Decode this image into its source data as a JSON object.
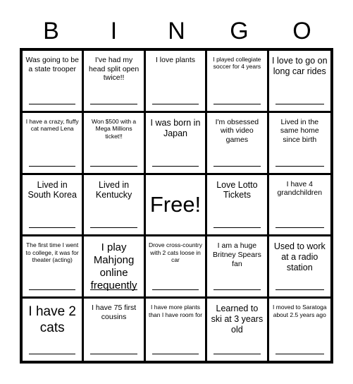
{
  "header": {
    "letters": [
      "B",
      "I",
      "N",
      "G",
      "O"
    ]
  },
  "grid": {
    "rows": [
      [
        {
          "text": "Was going to be a state trooper",
          "size": "sm",
          "line": true
        },
        {
          "text": "I've had my head split open twice!!",
          "size": "sm",
          "line": true
        },
        {
          "text": "I love plants",
          "size": "sm",
          "line": true
        },
        {
          "text": "I played collegiate soccer for 4 years",
          "size": "xs",
          "line": true
        },
        {
          "text": "I love to go on long car rides",
          "size": "md",
          "line": true
        }
      ],
      [
        {
          "text": "I have a crazy, fluffy cat named Lena",
          "size": "xs",
          "line": true
        },
        {
          "text": "Won $500 with a Mega Millions ticket!!",
          "size": "xs",
          "line": true
        },
        {
          "text": "I was born in Japan",
          "size": "md",
          "line": true
        },
        {
          "text": "I'm obsessed with video games",
          "size": "sm",
          "line": true
        },
        {
          "text": "Lived in the same home since birth",
          "size": "sm",
          "line": true
        }
      ],
      [
        {
          "text": "Lived in South Korea",
          "size": "md",
          "line": true
        },
        {
          "text": "Lived in Kentucky",
          "size": "md",
          "line": true
        },
        {
          "text": "Free!",
          "size": "free",
          "line": false,
          "free": true
        },
        {
          "text": "Love Lotto Tickets",
          "size": "md",
          "line": true
        },
        {
          "text": "I have 4 grandchildren",
          "size": "sm",
          "line": true
        }
      ],
      [
        {
          "text": "The first time I went to college, it was for theater (acting)",
          "size": "xs",
          "line": true
        },
        {
          "text": "I play Mahjong online frequently",
          "size": "lg",
          "line": true
        },
        {
          "text": "Drove cross-country with 2 cats loose in car",
          "size": "xs",
          "line": true
        },
        {
          "text": "I am a huge Britney Spears fan",
          "size": "sm",
          "line": true
        },
        {
          "text": "Used to work at a radio station",
          "size": "md",
          "line": true
        }
      ],
      [
        {
          "text": "I have 2 cats",
          "size": "xl",
          "line": true
        },
        {
          "text": "I have 75 first cousins",
          "size": "sm",
          "line": true
        },
        {
          "text": "I have more plants than I have room for",
          "size": "xs",
          "line": true
        },
        {
          "text": "Learned to ski at 3 years old",
          "size": "md",
          "line": true
        },
        {
          "text": "I moved to Saratoga about 2.5 years ago",
          "size": "xs",
          "line": true
        }
      ]
    ]
  },
  "colors": {
    "background": "#ffffff",
    "ink": "#000000"
  }
}
